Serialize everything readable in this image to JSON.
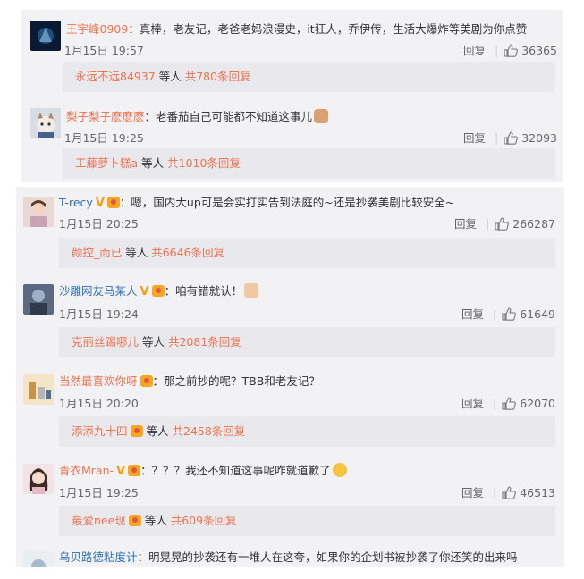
{
  "panel1": {
    "comments": [
      {
        "user": "王宇峰0909",
        "text": "真棒，老友记，老爸老妈浪漫史，it狂人，乔伊传，生活大爆炸等美剧为你点赞",
        "time": "1月15日 19:57",
        "reply_label": "回复",
        "likes": "36365",
        "replies": {
          "name": "永远不远84937",
          "mid": " 等人 ",
          "count": "共780条回复"
        }
      },
      {
        "user": "梨子梨子麽麽麽",
        "text": "老番茄自己可能都不知道这事儿",
        "time": "1月15日 19:25",
        "reply_label": "回复",
        "likes": "32093",
        "replies": {
          "name": "工藤萝卜糕a",
          "mid": " 等人 ",
          "count": "共1010条回复"
        }
      }
    ]
  },
  "panel2": {
    "comments": [
      {
        "user": "T-recy",
        "text": "嗯，国内大up可是会实打实告到法庭的~还是抄袭美剧比较安全~",
        "time": "1月15日 20:25",
        "reply_label": "回复",
        "likes": "266287",
        "replies": {
          "name": "颜控_而已",
          "mid": " 等人 ",
          "count": "共6646条回复"
        }
      },
      {
        "user": "沙雕网友马某人",
        "text": "咱有错就认！",
        "time": "1月15日 19:24",
        "reply_label": "回复",
        "likes": "61649",
        "replies": {
          "name": "克丽丝踢哪儿",
          "mid": " 等人 ",
          "count": "共2081条回复"
        }
      },
      {
        "user": "当然最喜欢你呀",
        "text": "那之前抄的呢？TBB和老友记？",
        "time": "1月15日 20:20",
        "reply_label": "回复",
        "likes": "62070",
        "replies": {
          "name": "添添九十四",
          "mid": " 等人 ",
          "count": "共2458条回复"
        }
      },
      {
        "user": "青衣Mran-",
        "text": "？？？我还不知道这事呢咋就道歉了",
        "time": "1月15日 19:25",
        "reply_label": "回复",
        "likes": "46513",
        "replies": {
          "name": "最爱nee现",
          "mid": " 等人 ",
          "count": "共609条回复"
        }
      },
      {
        "user": "乌贝路德粘度计",
        "text": "明晃晃的抄袭还有一堆人在这夸，如果你的企划书被抄袭了你还笑的出来吗"
      }
    ]
  },
  "colors": {
    "username": "#eb7350",
    "panel_bg": "#f2f2f5",
    "reply_bg": "#e9e9ed",
    "text": "#333333",
    "meta": "#666666",
    "vip_badge": "#f5a623"
  },
  "icons": {
    "like": "thumbs-up-icon",
    "vip": "vip-v-icon",
    "fan_badge": "fan-badge-icon"
  }
}
